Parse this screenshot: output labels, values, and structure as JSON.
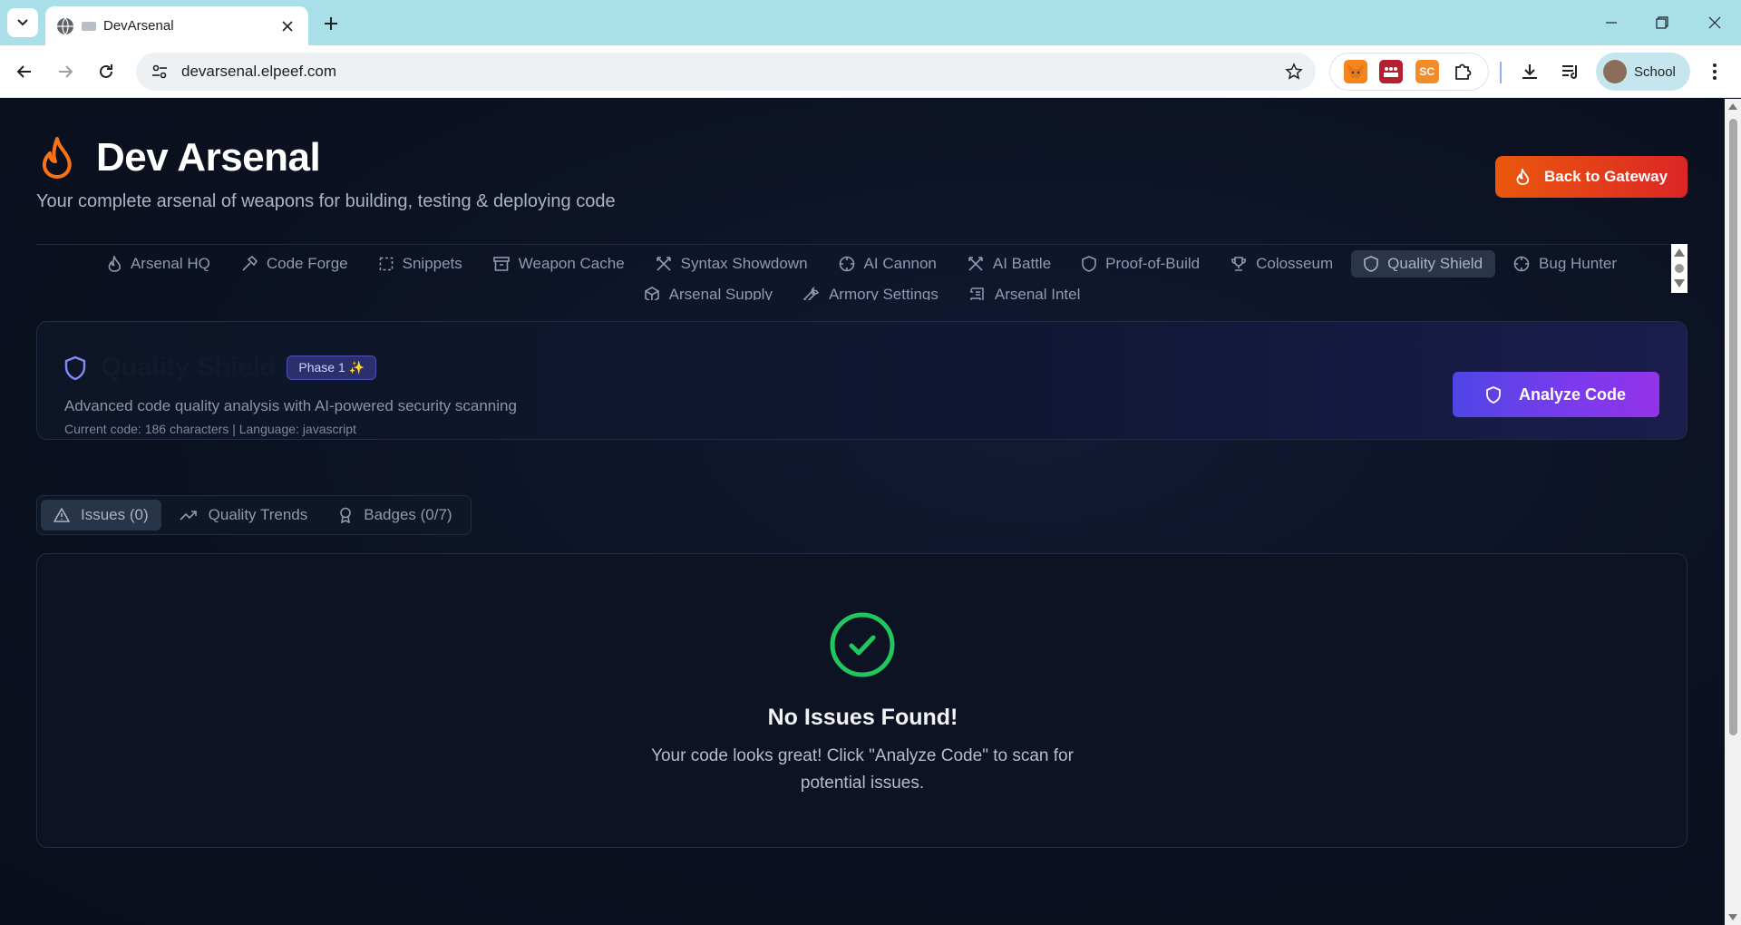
{
  "browser": {
    "tab_title": "DevArsenal",
    "url": "devarsenal.elpeef.com",
    "profile_name": "School",
    "extensions": [
      {
        "name": "fox-extension-icon",
        "color": "#f6851b"
      },
      {
        "name": "meetup-extension-icon",
        "color": "#b3212e"
      },
      {
        "name": "sc-extension-icon",
        "label": "SC",
        "color": "#f28c28"
      },
      {
        "name": "puzzle-extension-icon"
      }
    ]
  },
  "app": {
    "title": "Dev Arsenal",
    "subtitle": "Your complete arsenal of weapons for building, testing & deploying code",
    "gateway_button": "Back to Gateway",
    "accent_orange": "#ea580c",
    "accent_purple": "#7c3aed"
  },
  "nav": {
    "items": [
      {
        "label": "Arsenal HQ",
        "icon": "flame-icon"
      },
      {
        "label": "Code Forge",
        "icon": "hammer-icon"
      },
      {
        "label": "Snippets",
        "icon": "dashed-square-icon"
      },
      {
        "label": "Weapon Cache",
        "icon": "archive-icon"
      },
      {
        "label": "Syntax Showdown",
        "icon": "swords-icon"
      },
      {
        "label": "AI Cannon",
        "icon": "crosshair-icon"
      },
      {
        "label": "AI Battle",
        "icon": "swords-icon"
      },
      {
        "label": "Proof-of-Build",
        "icon": "shield-icon"
      },
      {
        "label": "Colosseum",
        "icon": "trophy-icon"
      },
      {
        "label": "Quality Shield",
        "icon": "shield-icon",
        "active": true
      },
      {
        "label": "Bug Hunter",
        "icon": "crosshair-icon"
      },
      {
        "label": "Arsenal Supply",
        "icon": "box-icon"
      },
      {
        "label": "Armory Settings",
        "icon": "wrench-icon"
      },
      {
        "label": "Arsenal Intel",
        "icon": "scroll-icon"
      }
    ]
  },
  "quality_shield": {
    "title": "Quality Shield",
    "phase_badge": "Phase 1 ✨",
    "description": "Advanced code quality analysis with AI-powered security scanning",
    "meta": "Current code: 186 characters | Language: javascript",
    "analyze_button": "Analyze Code"
  },
  "tabs": [
    {
      "label": "Issues (0)",
      "icon": "alert-triangle-icon",
      "active": true
    },
    {
      "label": "Quality Trends",
      "icon": "trending-up-icon"
    },
    {
      "label": "Badges (0/7)",
      "icon": "award-icon"
    }
  ],
  "result": {
    "title": "No Issues Found!",
    "message": "Your code looks great! Click \"Analyze Code\" to scan for potential issues.",
    "status_color": "#22c55e"
  }
}
